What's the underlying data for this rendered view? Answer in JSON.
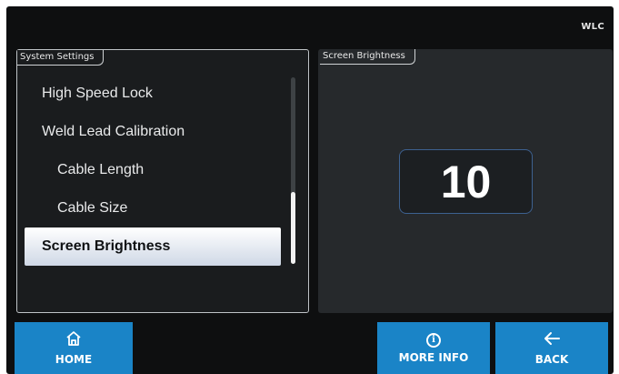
{
  "header": {
    "tag": "WLC"
  },
  "left_panel": {
    "title": "System Settings",
    "items": [
      {
        "label": "High Speed Lock",
        "level": 0,
        "selected": false
      },
      {
        "label": "Weld Lead Calibration",
        "level": 0,
        "selected": false
      },
      {
        "label": "Cable Length",
        "level": 1,
        "selected": false
      },
      {
        "label": "Cable Size",
        "level": 1,
        "selected": false
      },
      {
        "label": "Screen Brightness",
        "level": 0,
        "selected": true
      }
    ]
  },
  "right_panel": {
    "title": "Screen Brightness",
    "value": "10"
  },
  "footer": {
    "home_label": "HOME",
    "info_label": "MORE INFO",
    "back_label": "BACK",
    "home_icon": "home-icon",
    "info_icon": "info-icon",
    "back_icon": "arrow-left-icon"
  },
  "colors": {
    "button_blue": "#1a84c7",
    "screen_bg": "#0e0f10",
    "selected_bg": "#e8eef7"
  }
}
